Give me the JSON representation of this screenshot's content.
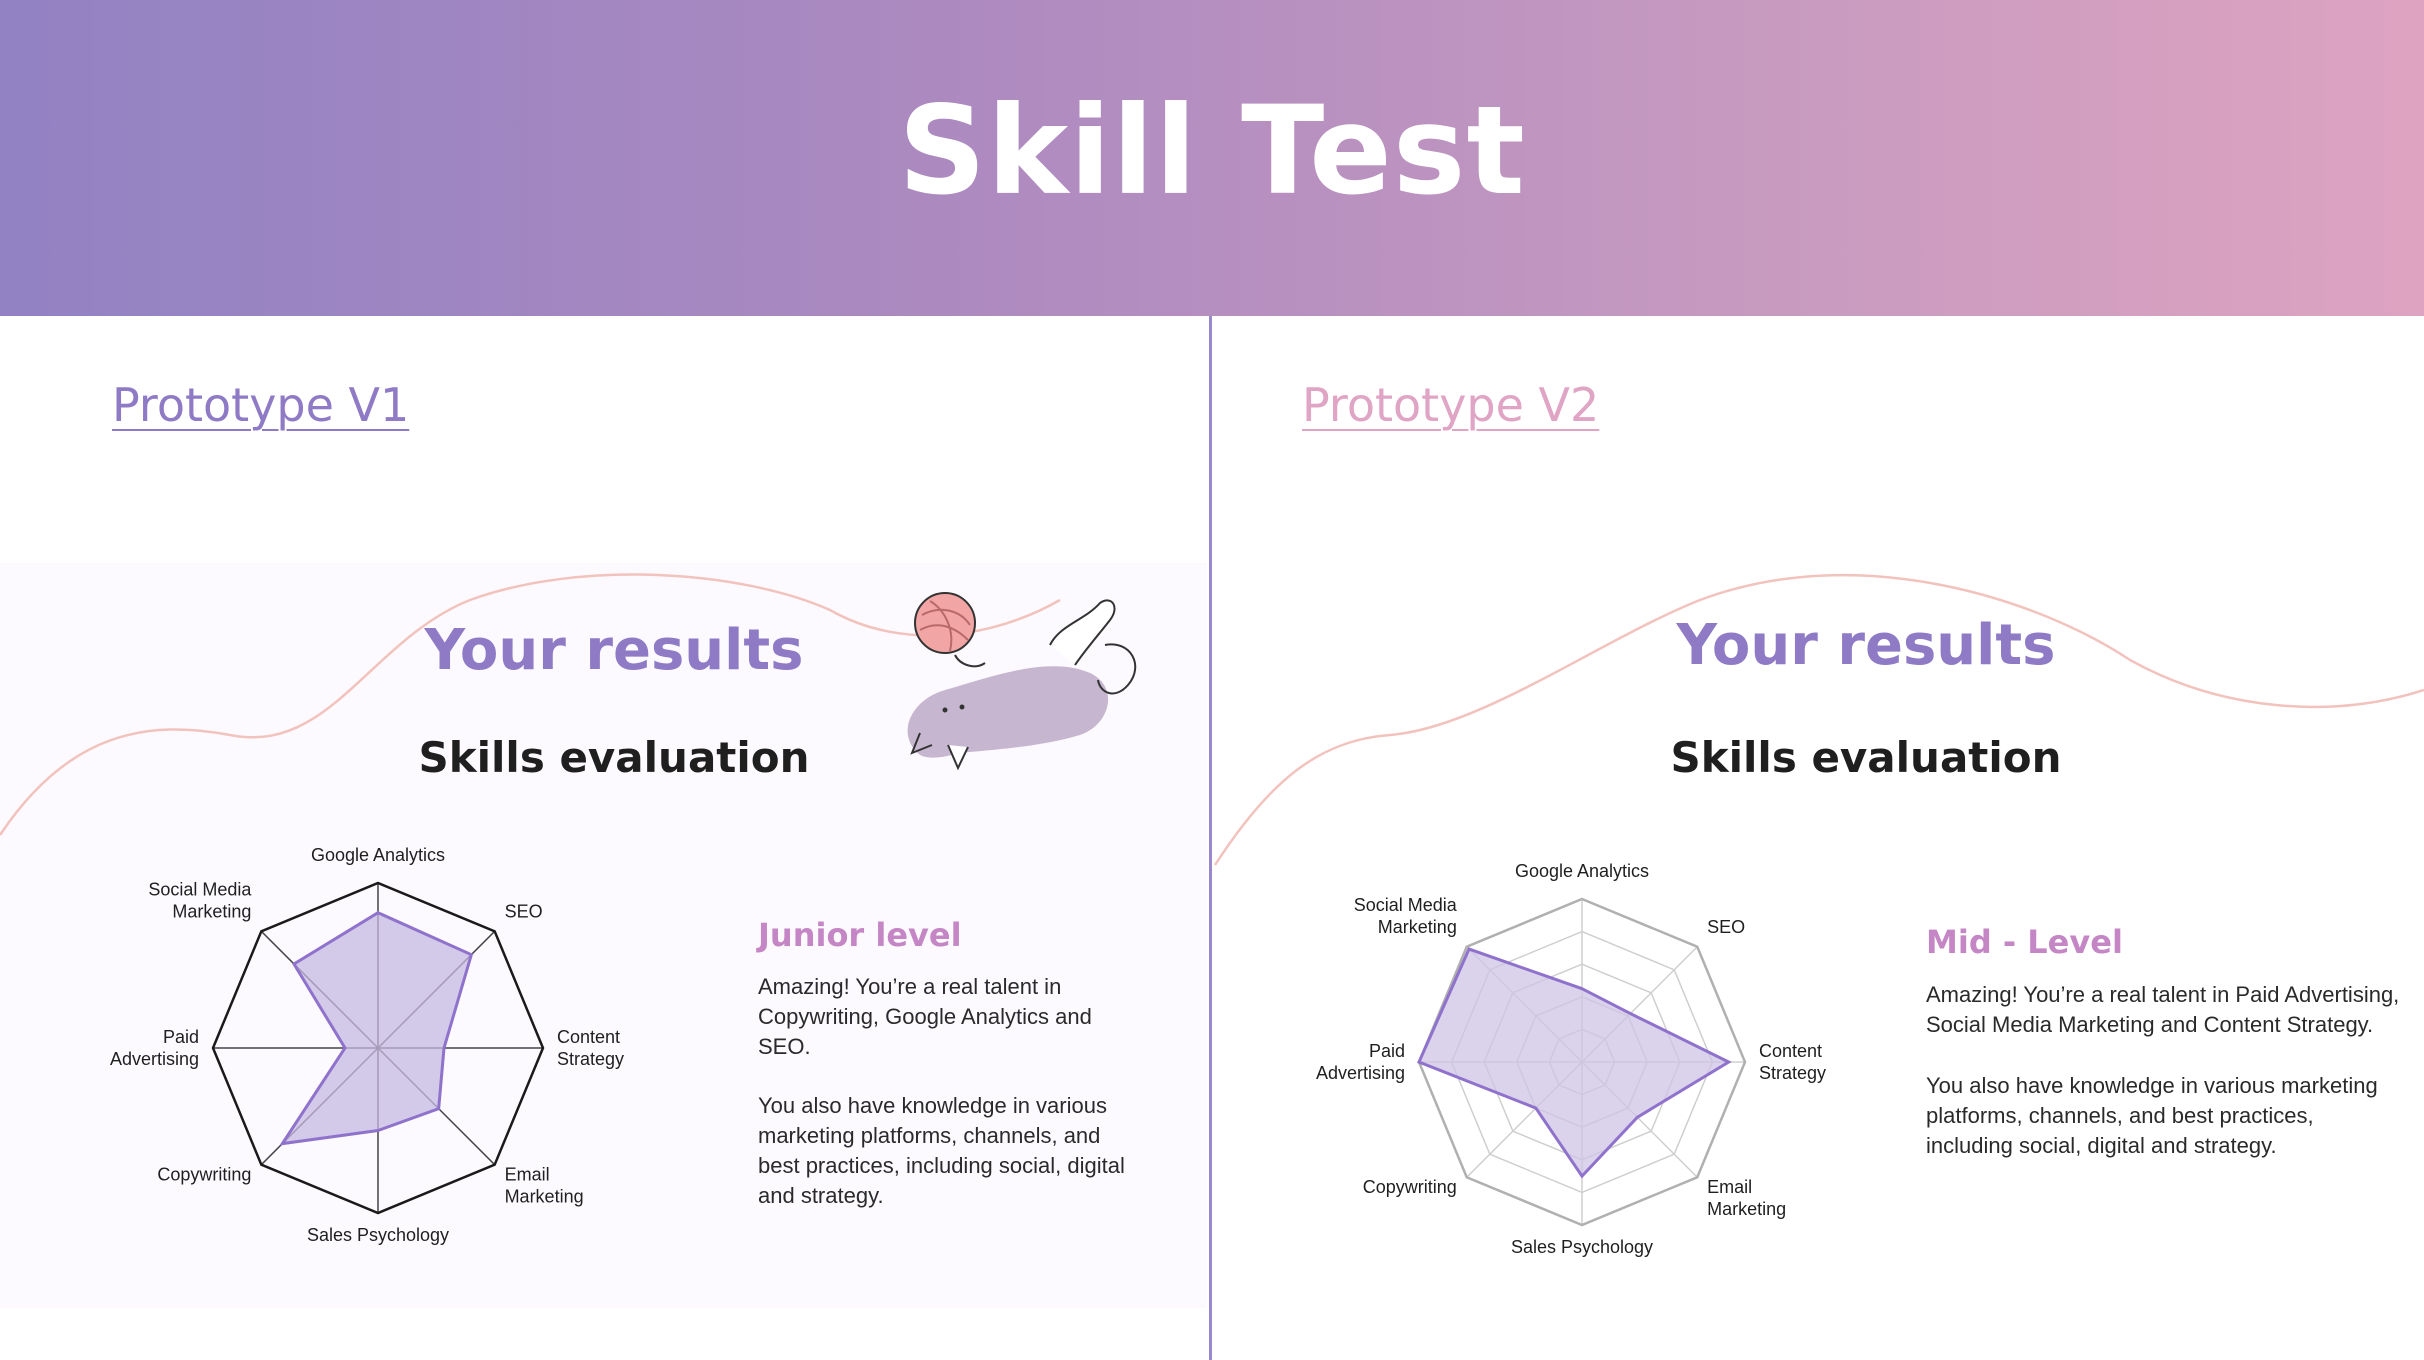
{
  "header": {
    "title": "Skill Test"
  },
  "prototypes": [
    {
      "link": "Prototype V1",
      "heading": "Your results",
      "subheading": "Skills evaluation",
      "level": "Junior level",
      "paragraph1": "Amazing! You’re a real talent in\nCopywriting, Google Analytics and\nSEO.",
      "paragraph2": "You also have knowledge in various\nmarketing platforms, channels, and\nbest practices, including social, digital\nand strategy."
    },
    {
      "link": "Prototype V2",
      "heading": "Your results",
      "subheading": "Skills evaluation",
      "level": "Mid - Level",
      "paragraph1": "Amazing! You’re a real talent in Paid Advertising,\nSocial Media Marketing and Content Strategy.",
      "paragraph2": "You also have knowledge in various marketing\nplatforms, channels, and best practices,\nincluding social, digital and strategy."
    }
  ],
  "chart_data": [
    {
      "type": "radar",
      "axes": [
        [
          "Google Analytics"
        ],
        [
          "SEO"
        ],
        [
          "Content",
          "Strategy"
        ],
        [
          "Email",
          "Marketing"
        ],
        [
          "Sales Psychology"
        ],
        [
          "Copywriting"
        ],
        [
          "Paid",
          "Advertising"
        ],
        [
          "Social Media",
          "Marketing"
        ]
      ],
      "values": [
        0.82,
        0.8,
        0.4,
        0.52,
        0.5,
        0.82,
        0.2,
        0.72
      ],
      "max": 1,
      "grid_rings": 0,
      "colors": {
        "fill": "#c5b8e0",
        "stroke": "#8f72cc",
        "frame": "#1a1a1a"
      }
    },
    {
      "type": "radar",
      "axes": [
        [
          "Google Analytics"
        ],
        [
          "SEO"
        ],
        [
          "Content",
          "Strategy"
        ],
        [
          "Email",
          "Marketing"
        ],
        [
          "Sales Psychology"
        ],
        [
          "Copywriting"
        ],
        [
          "Paid",
          "Advertising"
        ],
        [
          "Social Media",
          "Marketing"
        ]
      ],
      "values": [
        0.45,
        0.42,
        0.9,
        0.48,
        0.7,
        0.4,
        1.0,
        0.98
      ],
      "max": 1,
      "grid_rings": 4,
      "colors": {
        "fill": "#cfc3e6",
        "stroke": "#8f72cc",
        "frame": "#b0b0b0"
      }
    }
  ],
  "colors": {
    "banner_start": "#9282c3",
    "banner_end": "#dea3c1",
    "accent": "#8f7ac6",
    "pink": "#e0a4c4",
    "wave": "#f2c2bd"
  }
}
